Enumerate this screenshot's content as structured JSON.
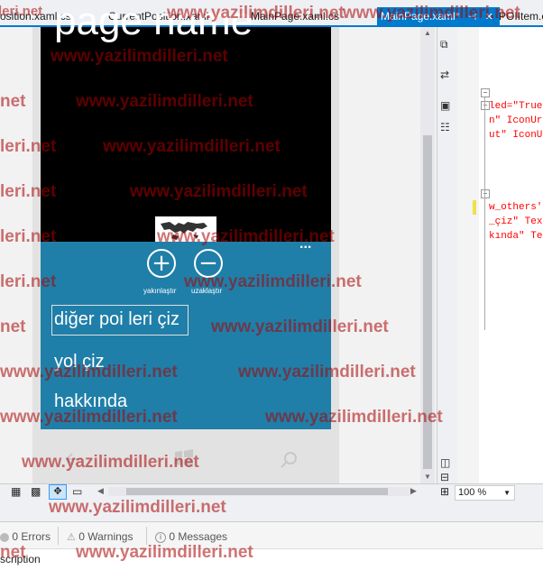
{
  "tabs": [
    {
      "label": "osition.xaml.cs"
    },
    {
      "label": "CurrentPosition.xaml"
    },
    {
      "label": "MainPage.xaml.cs"
    },
    {
      "label": "MainPage.xaml*"
    },
    {
      "label": "POIItem.cs"
    }
  ],
  "tab_icons": {
    "pin": "⊣",
    "close": "✕"
  },
  "phone": {
    "page_title": "page name",
    "appbar_buttons": [
      {
        "symbol": "+",
        "label": "yakınlaştır"
      },
      {
        "symbol": "−",
        "label": "uzaklaştır"
      }
    ],
    "more": "...",
    "menu_items": [
      "diğer poi leri çiz",
      "yol çiz",
      "hakkında"
    ]
  },
  "code_lines": [
    {
      "attr": "led=\"True",
      "val": ""
    },
    {
      "attr": "n\" IconUr",
      "val": ""
    },
    {
      "attr": "ut\" IconU",
      "val": ""
    },
    {
      "attr": "w_others'",
      "val": ""
    },
    {
      "attr": "_çiz\"",
      "val": "Tex"
    },
    {
      "attr": "kında\"",
      "val": "Te"
    }
  ],
  "zoom": "100 %",
  "status": {
    "errors": "0 Errors",
    "warnings": "0 Warnings",
    "messages": "0 Messages"
  },
  "description": "scription",
  "watermark": "www.yazilimdilleri.net",
  "watermark_short": "leri.net",
  "watermark_tiny": "net"
}
